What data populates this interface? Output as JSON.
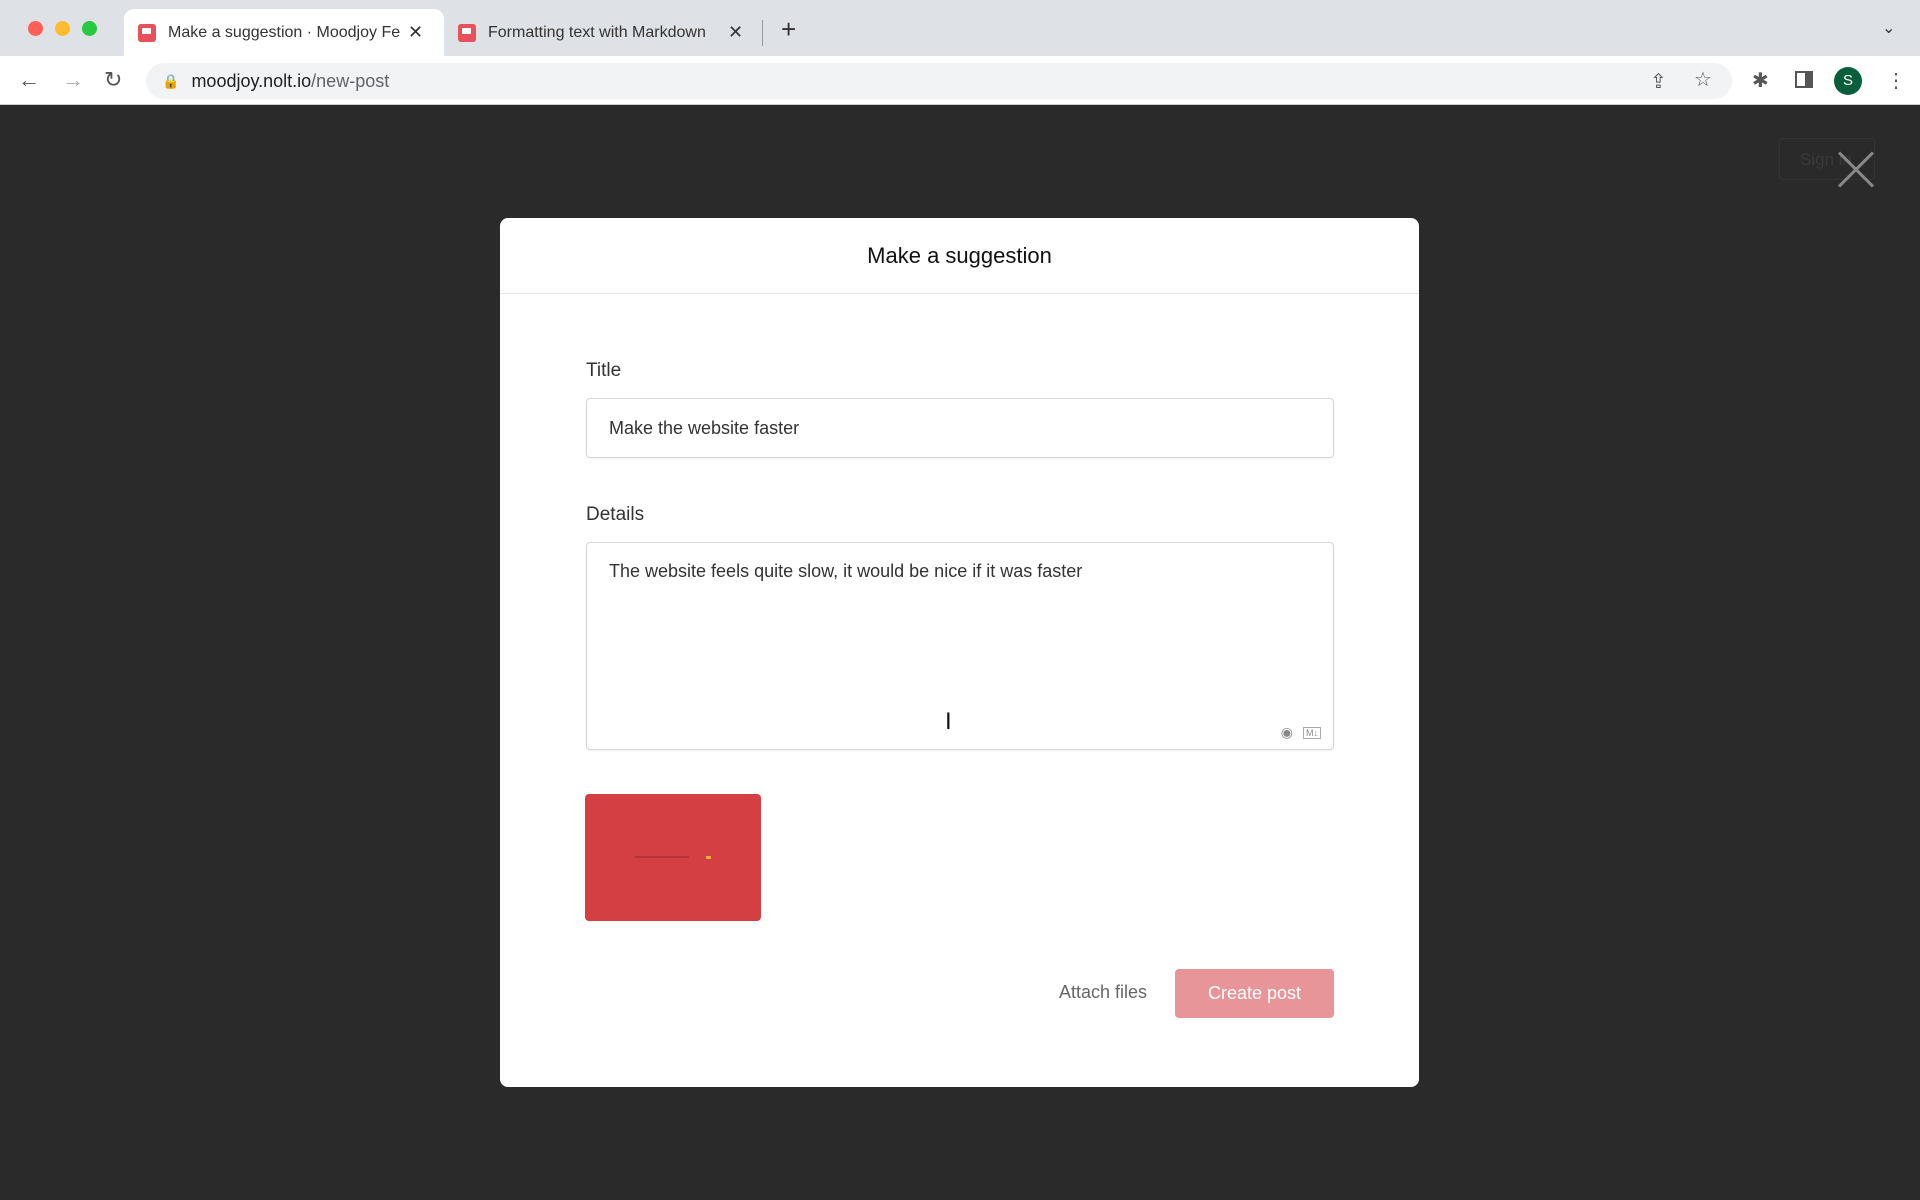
{
  "browser": {
    "tabs": [
      {
        "title": "Make a suggestion · Moodjoy Feedback",
        "active": true
      },
      {
        "title": "Formatting text with Markdown",
        "active": false
      }
    ],
    "new_tab_label": "+",
    "url_host": "moodjoy.nolt.io",
    "url_path": "/new-post",
    "profile_initial": "S",
    "icons": [
      "back-icon",
      "forward-icon",
      "reload-icon",
      "lock-icon",
      "share-icon",
      "star-icon",
      "extensions-icon",
      "sidepanel-icon",
      "menu-icon"
    ]
  },
  "page": {
    "sign_in_label": "Sign in"
  },
  "modal": {
    "title": "Make a suggestion",
    "title_label": "Title",
    "title_value": "Make the website faster",
    "details_label": "Details",
    "details_value": "The website feels quite slow, it would be nice if it was faster",
    "attach_label": "Attach files",
    "create_label": "Create post",
    "markdown_badge": "M↓",
    "accent": "#e8959a"
  }
}
